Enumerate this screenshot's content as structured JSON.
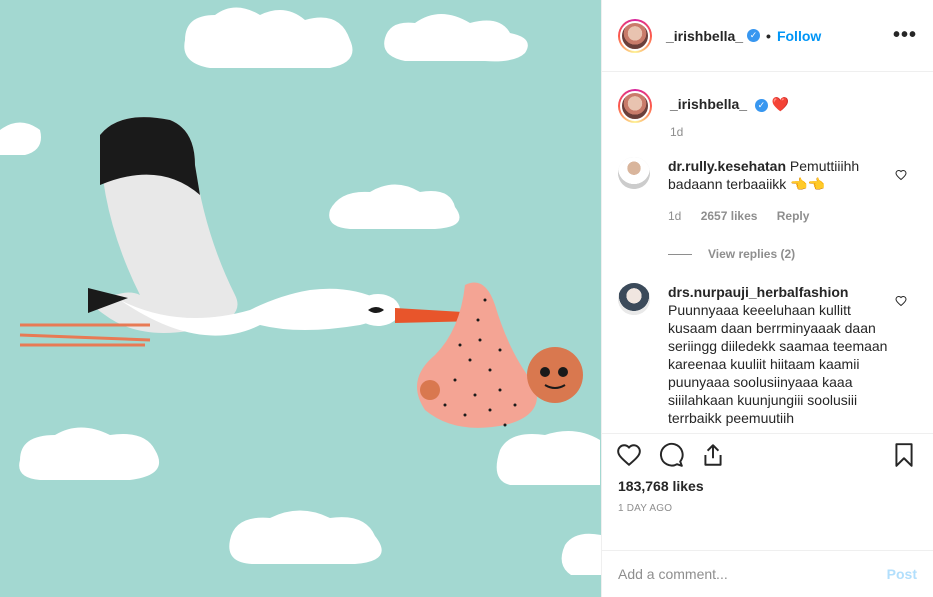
{
  "header": {
    "username": "_irishbella_",
    "verified_mark": "✓",
    "separator": "•",
    "follow_label": "Follow",
    "more_icon": "more-horizontal-icon"
  },
  "caption": {
    "username": "_irishbella_",
    "verified_mark": "✓",
    "text": "❤️",
    "age": "1d"
  },
  "comments": [
    {
      "username": "dr.rully.kesehatan",
      "text": "Pemuttiiihh badaann terbaaiikk 👈👈",
      "age": "1d",
      "likes": "2657 likes",
      "reply_label": "Reply",
      "view_replies": "View replies (2)"
    },
    {
      "username": "drs.nurpauji_herbalfashion",
      "text": "Puunnyaaa keeeluhaan kullitt kusaam daan berrminyaaak daan seriingg diiledekk saamaa teemaan kareenaa kuuliit hiitaam kaamii puunyaaa soolusiinyaaa kaaa siiilahkaan kuunjungiii soolusiii terrbaikk peemuutiih"
    }
  ],
  "actions": {
    "icons": [
      "heart-icon",
      "comment-icon",
      "share-icon",
      "bookmark-icon"
    ],
    "likes": "183,768 likes",
    "timestamp": "1 DAY AGO"
  },
  "add_comment": {
    "placeholder": "Add a comment...",
    "post_label": "Post"
  },
  "colors": {
    "sky": "#a3d8d1",
    "follow": "#0095f6",
    "post_disabled": "#b2dffc",
    "verified": "#3897f0"
  }
}
